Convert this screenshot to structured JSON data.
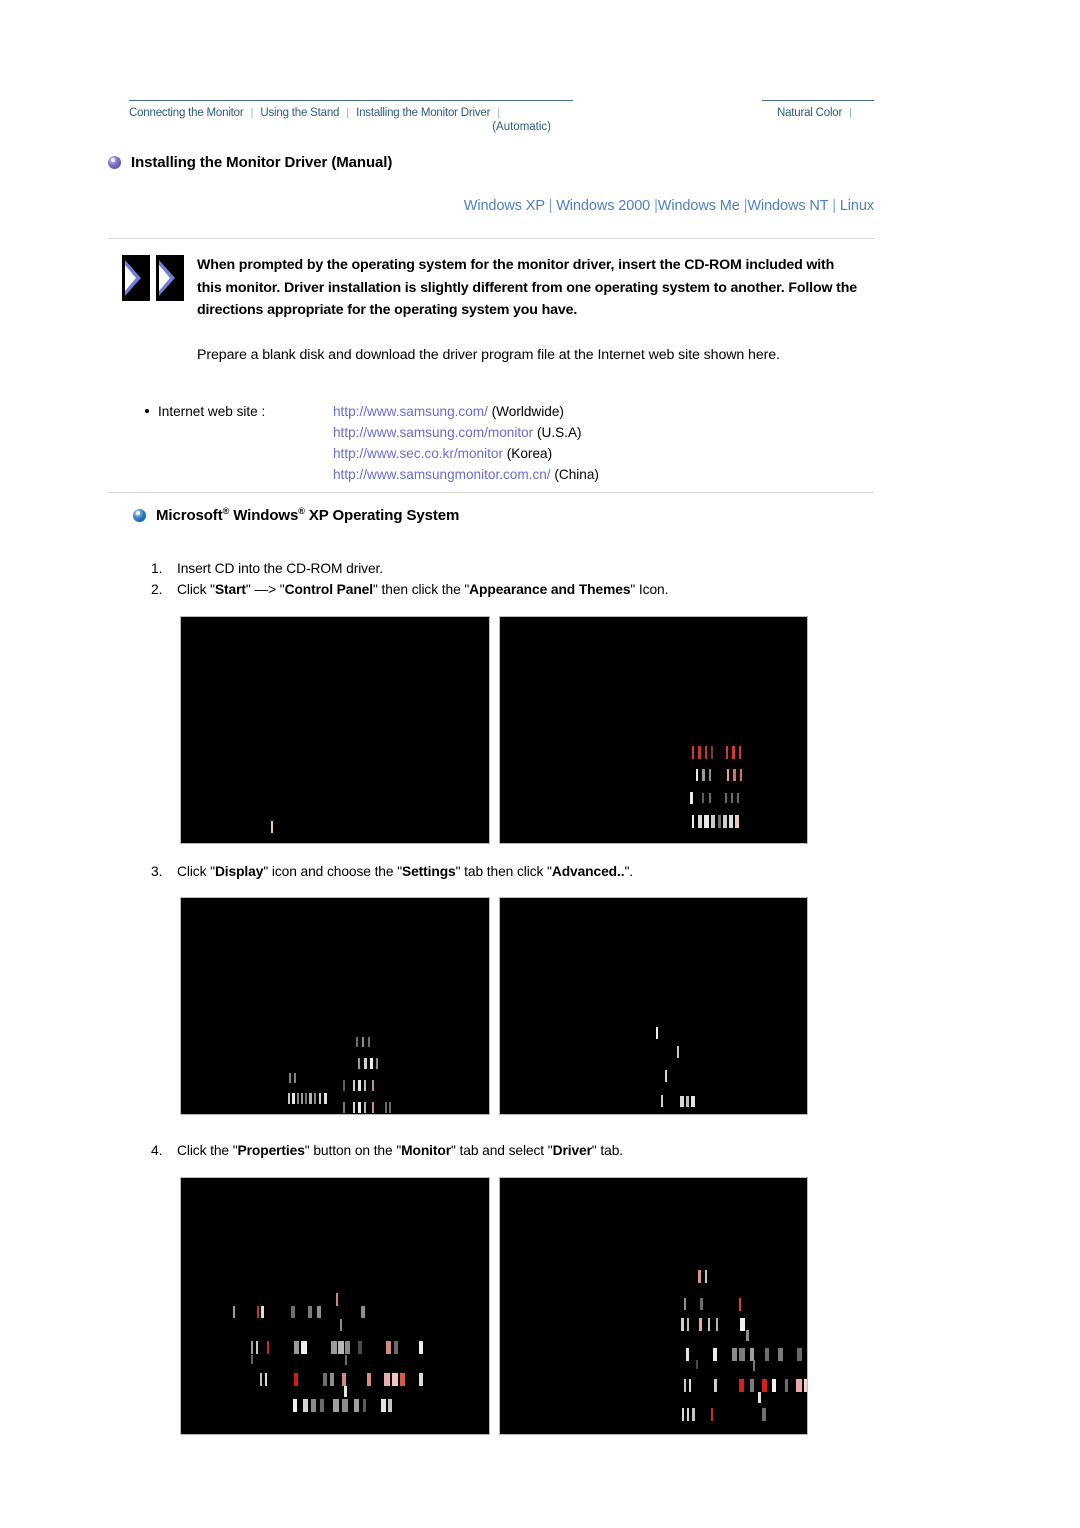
{
  "topnav": {
    "left_items": [
      {
        "label": "Connecting  the Monitor",
        "sub": ""
      },
      {
        "label": "Using the Stand",
        "sub": ""
      },
      {
        "label": "Installing the Monitor Driver",
        "sub": "(Automatic)"
      }
    ],
    "right_items": [
      {
        "label": "Natural Color"
      }
    ],
    "separator": "|",
    "link_color": "#2d5b7f"
  },
  "page_title": "Installing the Monitor Driver (Manual)",
  "os_links": {
    "items": [
      "Windows XP",
      "Windows 2000",
      "Windows Me",
      "Windows NT",
      "Linux"
    ],
    "separator": "|",
    "color": "#4f7fbf"
  },
  "note": {
    "bold": "When prompted by the operating system for the monitor driver, insert the CD-ROM included with this monitor. Driver installation is slightly different from one operating system to another. Follow the directions appropriate for the operating system you have.",
    "plain": "Prepare a blank disk and download the driver program file at the Internet web site shown here."
  },
  "web_site": {
    "label": "Internet web site :",
    "entries": [
      {
        "url": "http://www.samsung.com/",
        "region": "(Worldwide)"
      },
      {
        "url": "http://www.samsung.com/monitor",
        "region": "(U.S.A)"
      },
      {
        "url": "http://www.sec.co.kr/monitor",
        "region": "(Korea)"
      },
      {
        "url": "http://www.samsungmonitor.com.cn/",
        "region": "(China)"
      }
    ],
    "url_color": "#6b6bd0"
  },
  "os_section": {
    "heading_part1": "Microsoft",
    "heading_reg1": "®",
    "heading_part2": " Windows",
    "heading_reg2": "®",
    "heading_part3": " XP Operating System"
  },
  "steps": [
    {
      "number": "1.",
      "parts": [
        {
          "text": "Insert CD into the CD-ROM driver.",
          "bold": false
        }
      ]
    },
    {
      "number": "2.",
      "parts": [
        {
          "text": "Click \"",
          "bold": false
        },
        {
          "text": "Start",
          "bold": true
        },
        {
          "text": "\" —> \"",
          "bold": false
        },
        {
          "text": "Control Panel",
          "bold": true
        },
        {
          "text": "\" then click the \"",
          "bold": false
        },
        {
          "text": "Appearance and Themes",
          "bold": true
        },
        {
          "text": "\" Icon.",
          "bold": false
        }
      ]
    },
    {
      "number": "3.",
      "parts": [
        {
          "text": "Click \"",
          "bold": false
        },
        {
          "text": "Display",
          "bold": true
        },
        {
          "text": "\" icon and choose the \"",
          "bold": false
        },
        {
          "text": "Settings",
          "bold": true
        },
        {
          "text": "\" tab then click \"",
          "bold": false
        },
        {
          "text": "Advanced..",
          "bold": true
        },
        {
          "text": "\".",
          "bold": false
        }
      ]
    },
    {
      "number": "4.",
      "parts": [
        {
          "text": "Click the \"",
          "bold": false
        },
        {
          "text": "Properties",
          "bold": true
        },
        {
          "text": "\" button on the \"",
          "bold": false
        },
        {
          "text": "Monitor",
          "bold": true
        },
        {
          "text": "\" tab and select \"",
          "bold": false
        },
        {
          "text": "Driver",
          "bold": true
        },
        {
          "text": "\" tab.",
          "bold": false
        }
      ]
    }
  ],
  "screenshots": [
    {
      "name": "control-panel-window",
      "step": "2",
      "side": "left"
    },
    {
      "name": "appearance-and-themes-window",
      "step": "2",
      "side": "right"
    },
    {
      "name": "display-properties-settings-tab",
      "step": "3",
      "side": "left"
    },
    {
      "name": "advanced-dialog",
      "step": "3",
      "side": "right"
    },
    {
      "name": "monitor-tab-properties",
      "step": "4",
      "side": "left"
    },
    {
      "name": "driver-tab",
      "step": "4",
      "side": "right"
    }
  ],
  "colors": {
    "background": "#ffffff",
    "nav_link": "#2d5b7f",
    "os_link": "#4f7fbf",
    "url": "#6b6bd0",
    "rule": "#d9d9d9",
    "shot_bg": "#000000"
  }
}
